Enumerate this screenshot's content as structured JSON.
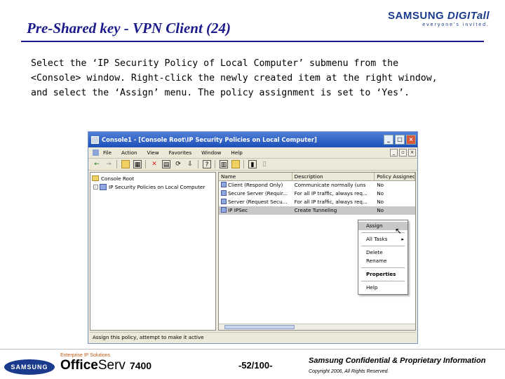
{
  "slide": {
    "title": "Pre-Shared key - VPN Client (24)",
    "brand_name": "SAMSUNG ",
    "brand_name_digit": "DIGITall",
    "brand_tag": "everyone's invited.",
    "body_lines": [
      "Select the ‘IP Security Policy of Local Computer’ submenu from the",
      "<Console> window. Right-click the newly created item at the right window,",
      "and select the ‘Assign’ menu. The policy assignment is set to ‘Yes’."
    ]
  },
  "window": {
    "title": "Console1 - [Console Root\\IP Security Policies on Local Computer]",
    "menu": [
      "File",
      "Action",
      "View",
      "Favorites",
      "Window",
      "Help"
    ],
    "tree": [
      {
        "label": "Console Root"
      },
      {
        "label": "IP Security Policies on Local Computer"
      }
    ],
    "columns": [
      "Name",
      "Description",
      "Policy Assigned"
    ],
    "rows": [
      {
        "name": "Client (Respond Only)",
        "desc": "Communicate normally (uns",
        "assigned": "No"
      },
      {
        "name": "Secure Server (Requir...",
        "desc": "For all IP traffic, always req...",
        "assigned": "No"
      },
      {
        "name": "Server (Request Secu...",
        "desc": "For all IP traffic, always req...",
        "assigned": "No"
      },
      {
        "name": "IP IPSec",
        "desc": "Create Tunneling",
        "assigned": "No"
      }
    ],
    "status": "Assign this policy, attempt to make it active",
    "context_menu": [
      {
        "label": "Assign"
      },
      {
        "label": "All Tasks"
      },
      {
        "label": "Delete"
      },
      {
        "label": "Rename"
      },
      {
        "label": "Properties"
      },
      {
        "label": "Help"
      }
    ]
  },
  "footer": {
    "logo": "SAMSUNG",
    "product_sub": "Enterprise IP Solutions",
    "product_name_a": "Office",
    "product_name_b": "Serv",
    "product_model": "7400",
    "page": "-52/100-",
    "confidential": "Samsung Confidential & Proprietary Information",
    "copyright": "Copyright 2006, All Rights Reserved."
  }
}
